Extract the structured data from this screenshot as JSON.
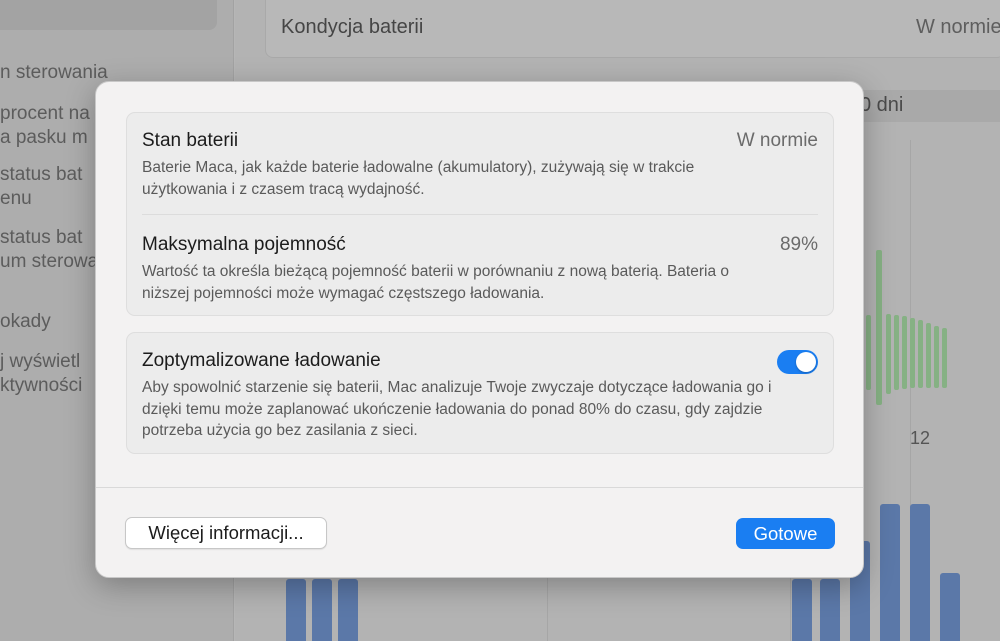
{
  "background": {
    "sidebar_items": [
      "n sterowania",
      "procent na",
      "a pasku m",
      "status bat",
      "enu",
      "status bat",
      "um sterowa",
      "okady",
      "j wyświetl",
      "ktywności"
    ],
    "battery_health_label": "Kondycja baterii",
    "battery_health_value": "W normie",
    "period_label": "0 dni",
    "chart_axis_label": "12"
  },
  "dialog": {
    "battery_state": {
      "title": "Stan baterii",
      "value": "W normie",
      "description": "Baterie Maca, jak każde baterie ładowalne (akumulatory), zużywają się w trakcie użytkowania i z czasem tracą wydajność."
    },
    "max_capacity": {
      "title": "Maksymalna pojemność",
      "value": "89%",
      "description": "Wartość ta określa bieżącą pojemność baterii w porównaniu z nową baterią. Bateria o niższej pojemności może wymagać częstszego ładowania."
    },
    "optimized_charging": {
      "title": "Zoptymalizowane ładowanie",
      "enabled": true,
      "description": "Aby spowolnić starzenie się baterii, Mac analizuje Twoje zwyczaje dotyczące ładowania go i dzięki temu może zaplanować ukończenie ładowania do ponad 80% do czasu, gdy zajdzie potrzeba użycia go bez zasilania z sieci."
    },
    "buttons": {
      "more_info": "Więcej informacji...",
      "done": "Gotowe"
    }
  },
  "colors": {
    "accent": "#1a7ef2",
    "chart_green": "#86b184",
    "chart_blue": "#5b78a8"
  }
}
